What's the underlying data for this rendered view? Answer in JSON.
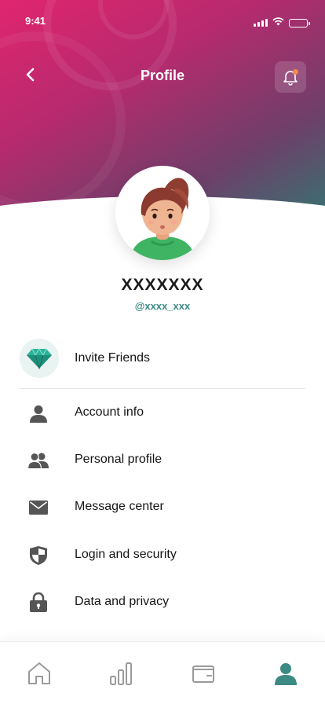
{
  "status_bar": {
    "time": "9:41"
  },
  "header": {
    "title": "Profile"
  },
  "profile": {
    "name": "XXXXXXX",
    "handle": "@xxxx_xxx"
  },
  "invite": {
    "label": "Invite Friends",
    "icon": "gem-icon"
  },
  "menu": [
    {
      "label": "Account info",
      "icon": "user-icon"
    },
    {
      "label": "Personal profile",
      "icon": "users-icon"
    },
    {
      "label": "Message center",
      "icon": "envelope-icon"
    },
    {
      "label": "Login and security",
      "icon": "shield-icon"
    },
    {
      "label": "Data and privacy",
      "icon": "lock-icon"
    }
  ],
  "tabs": [
    {
      "name": "home",
      "active": false
    },
    {
      "name": "stats",
      "active": false
    },
    {
      "name": "wallet",
      "active": false
    },
    {
      "name": "profile",
      "active": true
    }
  ],
  "colors": {
    "accent": "#3c8a84",
    "gradient_start": "#e0256f",
    "gradient_end": "#2f7a72",
    "notification_dot": "#f5894a",
    "icon_gray": "#555555"
  }
}
